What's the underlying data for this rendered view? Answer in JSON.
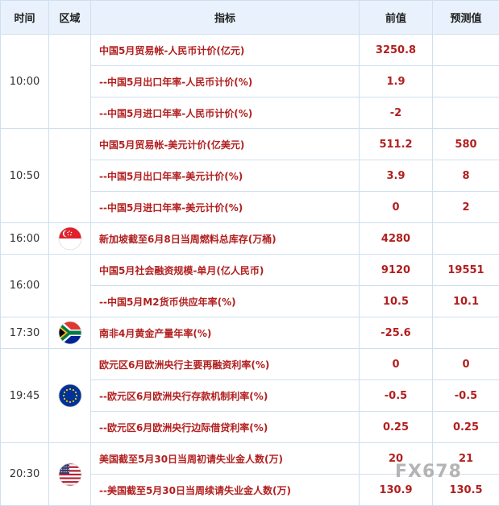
{
  "header": {
    "time": "时间",
    "region": "区域",
    "indicator": "指标",
    "previous": "前值",
    "forecast": "预测值"
  },
  "groups": [
    {
      "time": "10:00",
      "flag_icon": "blank",
      "rows": [
        {
          "indicator": "中国5月贸易帐-人民币计价(亿元)",
          "previous": "3250.8",
          "forecast": ""
        },
        {
          "indicator": "--中国5月出口年率-人民币计价(%)",
          "previous": "1.9",
          "forecast": ""
        },
        {
          "indicator": "--中国5月进口年率-人民币计价(%)",
          "previous": "-2",
          "forecast": ""
        }
      ]
    },
    {
      "time": "10:50",
      "flag_icon": "blank",
      "rows": [
        {
          "indicator": "中国5月贸易帐-美元计价(亿美元)",
          "previous": "511.2",
          "forecast": "580"
        },
        {
          "indicator": "--中国5月出口年率-美元计价(%)",
          "previous": "3.9",
          "forecast": "8"
        },
        {
          "indicator": "--中国5月进口年率-美元计价(%)",
          "previous": "0",
          "forecast": "2"
        }
      ]
    },
    {
      "time": "16:00",
      "flag_icon": "singapore",
      "rows": [
        {
          "indicator": "新加坡截至6月8日当周燃料总库存(万桶)",
          "previous": "4280",
          "forecast": ""
        }
      ]
    },
    {
      "time": "16:00",
      "flag_icon": "blank",
      "rows": [
        {
          "indicator": "中国5月社会融资规模-单月(亿人民币)",
          "previous": "9120",
          "forecast": "19551"
        },
        {
          "indicator": "--中国5月M2货币供应年率(%)",
          "previous": "10.5",
          "forecast": "10.1"
        }
      ]
    },
    {
      "time": "17:30",
      "flag_icon": "south-africa",
      "rows": [
        {
          "indicator": "南非4月黄金产量年率(%)",
          "previous": "-25.6",
          "forecast": ""
        }
      ]
    },
    {
      "time": "19:45",
      "flag_icon": "eu",
      "rows": [
        {
          "indicator": "欧元区6月欧洲央行主要再融资利率(%)",
          "previous": "0",
          "forecast": "0"
        },
        {
          "indicator": "--欧元区6月欧洲央行存款机制利率(%)",
          "previous": "-0.5",
          "forecast": "-0.5"
        },
        {
          "indicator": "--欧元区6月欧洲央行边际借贷利率(%)",
          "previous": "0.25",
          "forecast": "0.25"
        }
      ]
    },
    {
      "time": "20:30",
      "flag_icon": "usa",
      "rows": [
        {
          "indicator": "美国截至5月30日当周初请失业金人数(万)",
          "previous": "20",
          "forecast": "21"
        },
        {
          "indicator": "--美国截至5月30日当周续请失业金人数(万)",
          "previous": "130.9",
          "forecast": "130.5"
        }
      ]
    }
  ],
  "watermark": "FX678",
  "colors": {
    "header_bg": "#e9f2fc",
    "border": "#cfdff0",
    "value_red": "#b21f1f"
  }
}
